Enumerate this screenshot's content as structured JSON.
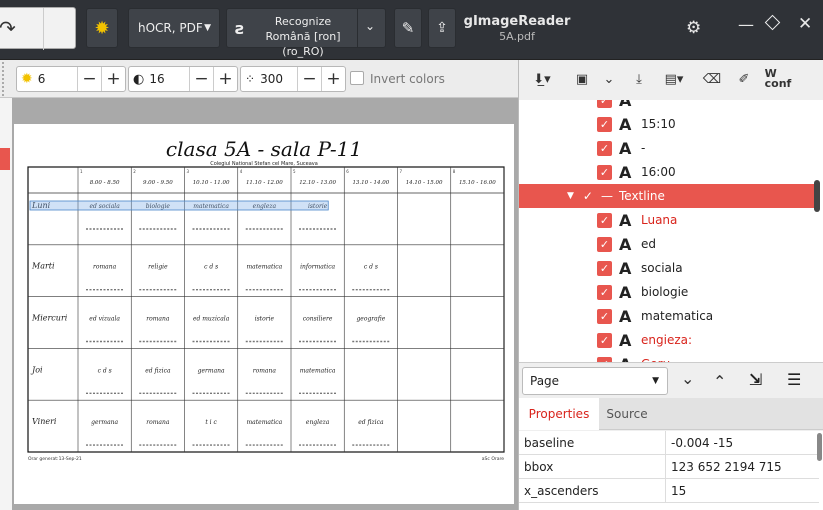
{
  "header": {
    "output_format": "hOCR, PDF",
    "recognize_label": "Recognize",
    "recognize_lang": "Română [ron] (ro_RO)",
    "app_title": "gImageReader",
    "app_subtitle": "5A.pdf"
  },
  "toolbar": {
    "brightness": "6",
    "contrast": "16",
    "resolution": "300",
    "invert_label": "Invert colors"
  },
  "document": {
    "title": "clasa 5A - sala P-11",
    "school": "Colegiul National Stefan cel Mare, Suceava",
    "times": [
      "8.00 - 8.50",
      "9.00 - 9.50",
      "10.10 - 11.00",
      "11.10 - 12.00",
      "12.10 - 13.00",
      "13.10 - 14.00",
      "14.10 - 15.00",
      "15.10 - 16.00"
    ],
    "days": [
      "Luni",
      "Marti",
      "Miercuri",
      "Joi",
      "Vineri"
    ],
    "cells": [
      [
        "ed sociala",
        "biologie",
        "matematica",
        "engleza",
        "istorie",
        "",
        "",
        ""
      ],
      [
        "romana",
        "religie",
        "c d s",
        "matematica",
        "informatica",
        "c d s",
        "",
        ""
      ],
      [
        "ed vizuala",
        "romana",
        "ed muzicala",
        "istorie",
        "consiliere",
        "geografie",
        "",
        ""
      ],
      [
        "c d s",
        "ed fizica",
        "germana",
        "romana",
        "matematica",
        "",
        "",
        ""
      ],
      [
        "germana",
        "romana",
        "t i c",
        "matematica",
        "engleza",
        "ed fizica",
        "",
        ""
      ]
    ],
    "footer_left": "Orar generat:13-Sep-21",
    "footer_right": "aSc Orare"
  },
  "tree": {
    "rows": [
      {
        "text": "",
        "red": false
      },
      {
        "text": "15:10",
        "red": false
      },
      {
        "text": "-",
        "red": false
      },
      {
        "text": "16:00",
        "red": false
      },
      {
        "text": "Textline",
        "red": false,
        "selected": true
      },
      {
        "text": "Luana",
        "red": true
      },
      {
        "text": "ed",
        "red": false
      },
      {
        "text": "sociala",
        "red": false
      },
      {
        "text": "biologie",
        "red": false
      },
      {
        "text": "matematica",
        "red": false
      },
      {
        "text": "engieza:",
        "red": true
      },
      {
        "text": "Goru",
        "red": true
      }
    ]
  },
  "pagebar": {
    "selected": "Page"
  },
  "tabs": {
    "properties": "Properties",
    "source": "Source"
  },
  "props": [
    {
      "key": "baseline",
      "value": "-0.004 -15"
    },
    {
      "key": "bbox",
      "value": "123 652 2194 715"
    },
    {
      "key": "x_ascenders",
      "value": "15"
    }
  ],
  "colors": {
    "accent": "#e8564e",
    "header_bg": "#2f3237"
  }
}
